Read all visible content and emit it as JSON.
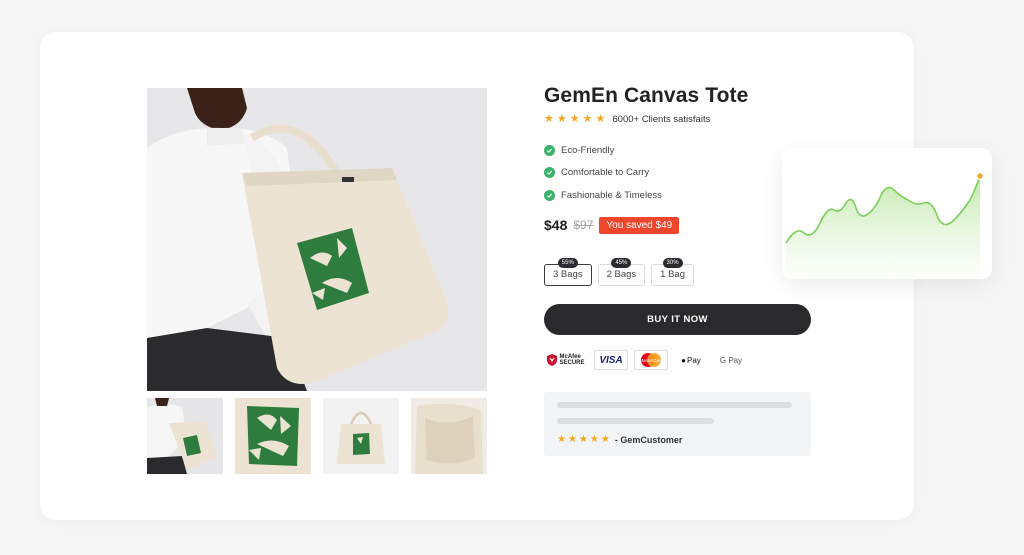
{
  "product": {
    "title": "GemEn Canvas Tote",
    "rating_text": "6000+ Clients satisfaits",
    "star_count": 5,
    "features": [
      {
        "label": "Eco-Friendly"
      },
      {
        "label": "Comfortable to Carry"
      },
      {
        "label": "Fashionable & Timeless"
      }
    ],
    "price": "$48",
    "old_price": "$97",
    "saved": "You saved $49",
    "bundles": [
      {
        "label": "3 Bags",
        "badge": "55%",
        "selected": true
      },
      {
        "label": "2 Bags",
        "badge": "45%",
        "selected": false
      },
      {
        "label": "1 Bag",
        "badge": "30%",
        "selected": false
      }
    ],
    "buy_label": "BUY IT NOW"
  },
  "payments": {
    "mcafee_top": "McAfee",
    "mcafee_bottom": "SECURE",
    "visa": "VISA",
    "mastercard": "MasterCard",
    "apple": "Pay",
    "google": "G Pay"
  },
  "review": {
    "stars": 5,
    "author": "- GemCustomer"
  },
  "colors": {
    "accent": "#f0462c",
    "check": "#3bb36a",
    "button": "#2a2a2d",
    "chart_line": "#7bcf5a",
    "chart_dot": "#f5a623",
    "star": "#f5a623"
  },
  "icons": [
    "star-icon",
    "check-icon",
    "mcafee-shield-icon",
    "visa-icon",
    "mastercard-icon",
    "apple-pay-icon",
    "google-pay-icon"
  ]
}
